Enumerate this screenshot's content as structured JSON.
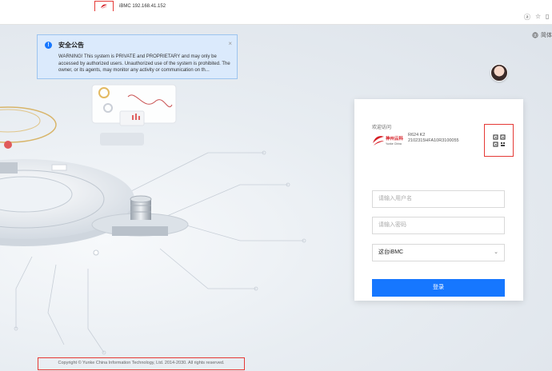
{
  "browser": {
    "tab_title": "iBMC 192.168.41.152",
    "toolbar_icons": [
      "translate-icon",
      "star-icon",
      "split-icon"
    ]
  },
  "page": {
    "language_label": "简体"
  },
  "notice": {
    "title": "安全公告",
    "body": "WARNING! This system is PRIVATE and PROPRIETARY and may only be accessed by authorized users. Unauthorized use of the system is prohibited. The owner, or its agents, may monitor any activity or communication on th...",
    "close_symbol": "×"
  },
  "login": {
    "welcome": "欢迎访问",
    "brand_cn": "神州云科",
    "brand_en": "Yunke China",
    "model": "R624 K2",
    "serial": "2102315HFA10R3100055",
    "username_placeholder": "请输入用户名",
    "password_placeholder": "请输入密码",
    "domain_selected": "这台iBMC",
    "login_label": "登录"
  },
  "footer": {
    "copyright": "Copyright © Yunke China Information Technology, Ltd. 2014-2030. All rights reserved."
  },
  "colors": {
    "accent": "#1677ff",
    "highlight_box": "#e53935",
    "notice_bg": "#dbeafc",
    "brand_red": "#d61f26"
  }
}
